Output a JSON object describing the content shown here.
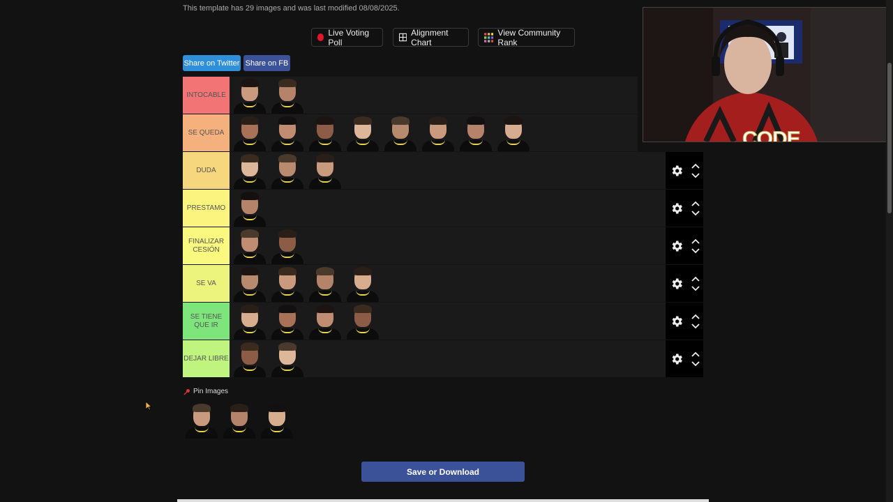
{
  "info_text": "This template has 29 images and was last modified 08/08/2025.",
  "top_buttons": [
    {
      "label": "Live Voting Poll",
      "icon": "red-dot-icon"
    },
    {
      "label": "Alignment Chart",
      "icon": "grid-icon"
    },
    {
      "label": "View Community Rank",
      "icon": "rank-grid-icon"
    }
  ],
  "share": {
    "twitter": "Share on Twitter",
    "fb": "Share on FB"
  },
  "colors": {
    "twitter": "#2f8fd8",
    "fb": "#3b5298",
    "tiers": [
      "#f27474",
      "#f4b17e",
      "#f7d77e",
      "#fbf57f",
      "#f9f97f",
      "#ecf47e",
      "#7ee57d",
      "#bff47f"
    ]
  },
  "tiers": [
    {
      "label": "INTOCABLE",
      "players": 2,
      "controls": false
    },
    {
      "label": "SE QUEDA",
      "players": 8,
      "controls": false
    },
    {
      "label": "DUDA",
      "players": 3,
      "controls": true
    },
    {
      "label": "PRESTAMO",
      "players": 1,
      "controls": true
    },
    {
      "label": "FINALIZAR CESIÓN",
      "players": 2,
      "controls": true
    },
    {
      "label": "SE VA",
      "players": 4,
      "controls": true
    },
    {
      "label": "SE TIENE QUE IR",
      "players": 4,
      "controls": true
    },
    {
      "label": "DEJAR LIBRE",
      "players": 2,
      "controls": true
    }
  ],
  "pin_label": "Pin Images",
  "pool_players": 3,
  "save_label": "Save or Download",
  "webcam": {
    "overlay_text": "CODE"
  }
}
